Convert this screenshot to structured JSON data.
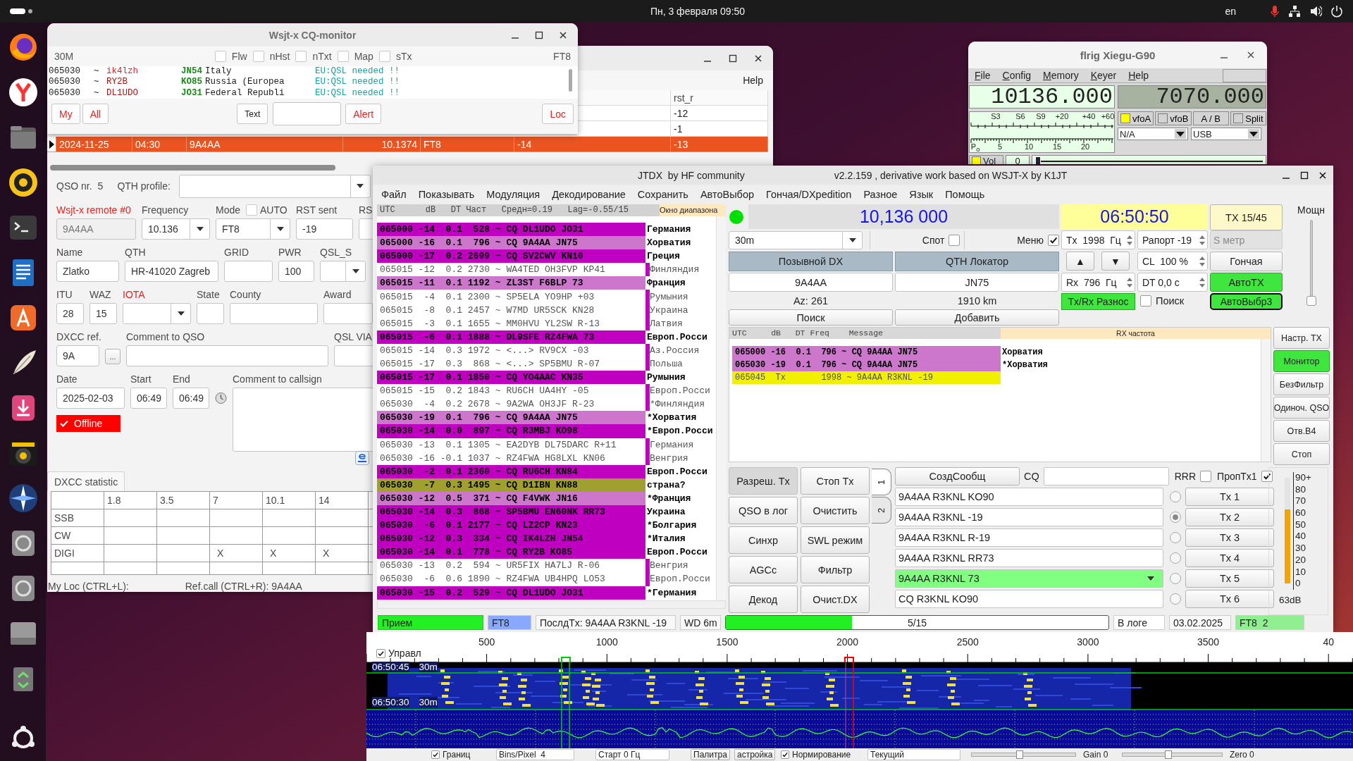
{
  "top_bar": {
    "clock": "Пн, 3 февраля 09:50",
    "language": "en"
  },
  "cq_monitor": {
    "title": "Wsjt-x CQ-monitor",
    "band": "30M",
    "mode": "FT8",
    "filters": [
      {
        "label": "Flw",
        "checked": false
      },
      {
        "label": "nHst",
        "checked": false
      },
      {
        "label": "nTxt",
        "checked": false
      },
      {
        "label": "Map",
        "checked": false
      },
      {
        "label": "sTx",
        "checked": false
      }
    ],
    "spots": [
      {
        "time": "065030",
        "sep": "~",
        "call": "ik4lzh",
        "color": "#e8202a",
        "locator": "JN54",
        "country": "Italy",
        "note": "EU:QSL needed !!"
      },
      {
        "time": "065030",
        "sep": "~",
        "call": "RY2B",
        "color": "#a01818",
        "locator": "KO85",
        "country": "Russia (Europea",
        "note": "EU:QSL needed !!"
      },
      {
        "time": "065030",
        "sep": "~",
        "call": "DL1UDO",
        "color": "#a01818",
        "locator": "JO31",
        "country": "Federal Republi",
        "note": "EU:QSL needed !!"
      }
    ],
    "my_button": "My",
    "all_button": "All",
    "text_button": "Text",
    "alert_button": "Alert",
    "loc_button": "Loc"
  },
  "log_window": {
    "menu_right": "Help",
    "header": {
      "rst_r": "rst_r"
    },
    "rows": [
      {
        "selected": false,
        "rst_r": "-12"
      },
      {
        "selected": false,
        "rst_r": "-1"
      },
      {
        "selected": true,
        "date": "2024-11-25",
        "time": "04:30",
        "call": "9A4AA",
        "freq": "10.1374",
        "mode": "FT8",
        "rst_s": "-14",
        "rst_r": "-13"
      }
    ],
    "form": {
      "qso_nr_label": "QSO nr.",
      "qso_nr": "5",
      "qth_profile_label": "QTH profile:",
      "sections": [
        {
          "fields": [
            {
              "label": "Wsjt-x remote #0",
              "warn": true,
              "kind": "field",
              "value": "9A4AA",
              "disabled": true
            },
            {
              "label": "Frequency",
              "warn": false,
              "kind": "combo",
              "value": "10.136"
            },
            {
              "label": "Mode",
              "warn": false,
              "kind": "combo",
              "value": "FT8",
              "option": {
                "label": "AUTO",
                "checked": false
              }
            },
            {
              "label": "RST sent",
              "warn": false,
              "kind": "field",
              "value": "-19"
            },
            {
              "label": "RS",
              "warn": false,
              "kind": "field"
            }
          ]
        },
        {
          "fields": [
            {
              "label": "Name",
              "warn": false,
              "kind": "field",
              "value": "Zlatko"
            },
            {
              "label": "QTH",
              "warn": false,
              "kind": "field",
              "value": "HR-41020 Zagreb"
            },
            {
              "label": "GRID",
              "warn": false,
              "kind": "field"
            },
            {
              "label": "PWR",
              "warn": false,
              "kind": "field",
              "value": "100"
            },
            {
              "label": "QSL_S",
              "warn": false,
              "kind": "combo"
            }
          ]
        },
        {
          "fields": [
            {
              "label": "ITU",
              "warn": false,
              "kind": "field",
              "value": "28"
            },
            {
              "label": "WAZ",
              "warn": false,
              "kind": "field",
              "value": "15"
            },
            {
              "label": "IOTA",
              "warn": true,
              "kind": "combo"
            },
            {
              "label": "State",
              "warn": false,
              "kind": "field"
            },
            {
              "label": "County",
              "warn": false,
              "kind": "field"
            },
            {
              "label": "Award",
              "warn": false,
              "kind": "field"
            }
          ]
        },
        {
          "fields": [
            {
              "label": "DXCC ref.",
              "warn": false,
              "kind": "field",
              "value": "9A"
            },
            {
              "kind": "button",
              "value": "..."
            },
            {
              "label": "Comment to QSO",
              "warn": false,
              "kind": "field"
            },
            {
              "label": "QSL VIA",
              "warn": false,
              "kind": "field"
            }
          ]
        },
        {
          "fields": [
            {
              "label": "Date",
              "warn": false,
              "kind": "field",
              "value": "2025-02-03"
            },
            {
              "label": "Start",
              "warn": false,
              "kind": "field",
              "value": "06:49"
            },
            {
              "label": "End",
              "warn": false,
              "kind": "field",
              "value": "06:49"
            },
            {
              "kind": "clock"
            },
            {
              "label": "Comment to callsign",
              "warn": false,
              "kind": "memo"
            }
          ]
        }
      ],
      "offline": {
        "label": "Offline",
        "checked": true
      },
      "stats_tab": "DXCC statistic",
      "stats": {
        "columns": [
          "1.8",
          "3.5",
          "7",
          "10.1",
          "14"
        ],
        "rows": [
          {
            "mode": "SSB"
          },
          {
            "mode": "CW"
          },
          {
            "mode": "DIGI",
            "cells": [
              null,
              null,
              "X",
              "X",
              "X"
            ]
          }
        ]
      },
      "my_loc": "My Loc (CTRL+L):",
      "ref_call": "Ref.call (CTRL+R): 9A4AA"
    }
  },
  "flrig": {
    "title": "flrig Xiegu-G90",
    "menu": [
      "File",
      "Config",
      "Memory",
      "Keyer",
      "Help"
    ],
    "vfo_a": "10136.000",
    "vfo_b": "7070.000",
    "s_scale": [
      "S3",
      "S6",
      "S9",
      "+20",
      "+40",
      "+60"
    ],
    "po_scale": [
      "P$_{o}$",
      "5",
      "10",
      "15",
      "20"
    ],
    "toggles": [
      {
        "label": "vfoA",
        "kind": "check",
        "checked": true
      },
      {
        "label": "vfoB",
        "kind": "check",
        "checked": false
      },
      {
        "label": "A / B",
        "kind": "plain"
      },
      {
        "label": "Split",
        "kind": "check",
        "checked": false
      }
    ],
    "combos": [
      "N/A",
      "USB"
    ],
    "volume": {
      "label": "Vol",
      "checked": true,
      "value": "0",
      "level": 0
    }
  },
  "jtdx": {
    "title": "JTDX  by HF community",
    "version": "v2.2.159 , derivative work based on WSJT-X by K1JT",
    "menu": [
      "Файл",
      "Показывать",
      "Модуляция",
      "Декодирование",
      "Сохранить",
      "АвтоВыбор",
      "Гончая/DXpedition",
      "Разное",
      "Язык",
      "Помощь"
    ],
    "band_activity": {
      "header": "UTC      dB   DT Част   Средн=0.19   Lag=-0.55/15",
      "side_header": "Окно диапазона",
      "rows": [
        {
          "text": "065000 -14  0.1  528 ~ CQ DL1UDO JO31",
          "country": "Германия",
          "color": "#c000c0",
          "bold": true
        },
        {
          "text": "065000 -16  0.1  796 ~ CQ 9A4AA JN75",
          "country": "Хорватия",
          "color": "#cc77cc",
          "bold": true
        },
        {
          "text": "065000 -17  0.2 2699 ~ CQ SV2CWV KN10",
          "country": "Греция",
          "color": "#c000c0",
          "bold": true
        },
        {
          "text": "065015 -12  0.2 2730 ~ WA4TED OH3FVP KP41",
          "country": "Финляндия",
          "color": "#ffffff",
          "bold": false
        },
        {
          "text": "065015 -11  0.1 1192 ~ ZL3ST F6BLP 73",
          "country": "Франция",
          "color": "#cc77cc",
          "bold": true
        },
        {
          "text": "065015  -4  0.1 2300 ~ SP5ELA YO9HP +03",
          "country": "Румыния",
          "color": "#ffffff",
          "bold": false
        },
        {
          "text": "065015  -8  0.1 2457 ~ W7MD UR5SCK KN28",
          "country": "Украина",
          "color": "#ffffff",
          "bold": false
        },
        {
          "text": "065015  -3  0.1 1655 ~ MM0HVU YL2SW R-13",
          "country": "Латвия",
          "color": "#ffffff",
          "bold": false
        },
        {
          "text": "065015  -6  0.1 1888 ~ DL9SFE RZ4FWA 73",
          "country": "Европ.Росси",
          "color": "#c000c0",
          "bold": true
        },
        {
          "text": "065015 -14  0.3 1972 ~ <...> RV9CX -03",
          "country": "Аз.Россия",
          "color": "#ffffff",
          "bold": false
        },
        {
          "text": "065015 -17  0.3  868 ~ <...> SP5BMU R-07",
          "country": "Польша",
          "color": "#ffffff",
          "bold": false
        },
        {
          "text": "065015 -17  0.1 1850 ~ CQ YO4AAC KN35",
          "country": "Румыния",
          "color": "#c000c0",
          "bold": true
        },
        {
          "text": "065015 -15  0.2 1843 ~ RU6CH UA4HY -05",
          "country": "Европ.Росси",
          "color": "#ffffff",
          "bold": false
        },
        {
          "text": "065030  -4  0.2 2678 ~ 9A2WA OH3JF R-23",
          "country": "*Финляндия",
          "color": "#ffffff",
          "bold": false
        },
        {
          "text": "065030 -19  0.1  796 ~ CQ 9A4AA JN75",
          "country": "*Хорватия",
          "color": "#cc77cc",
          "bold": true
        },
        {
          "text": "065030 -14  0.0  897 ~ CQ R3MBJ KO98",
          "country": "*Европ.Росси",
          "color": "#c000c0",
          "bold": true
        },
        {
          "text": "065030 -13  0.1 1305 ~ EA2DYB DL75DARC R+11",
          "country": "Германия",
          "color": "#ffffff",
          "bold": false
        },
        {
          "text": "065030 -16 -0.1 1037 ~ RZ4FWA HG8LXL KN06",
          "country": "Венгрия",
          "color": "#ffffff",
          "bold": false
        },
        {
          "text": "065030  -2  0.1 2360 ~ CQ RU6CH KN84",
          "country": "Европ.Росси",
          "color": "#c000c0",
          "bold": true
        },
        {
          "text": "065030  -7  0.3 1495 ~ CQ D1IBN KN88",
          "country": "страна?",
          "color": "#a0a030",
          "bold": true
        },
        {
          "text": "065030 -12  0.5  371 ~ CQ F4VWK JN16",
          "country": "*Франция",
          "color": "#cc77cc",
          "bold": true
        },
        {
          "text": "065030 -14  0.3  868 ~ SP5BMU EN60NK RR73",
          "country": "Украина",
          "color": "#c000c0",
          "bold": true
        },
        {
          "text": "065030  -6  0.1 2177 ~ CQ LZ2CP KN23",
          "country": "*Болгария",
          "color": "#c000c0",
          "bold": true
        },
        {
          "text": "065030 -12  0.3  334 ~ CQ IK4LZH JN54",
          "country": "*Италия",
          "color": "#c000c0",
          "bold": true
        },
        {
          "text": "065030 -14  0.1  778 ~ CQ RY2B KO85",
          "country": "Европ.Росси",
          "color": "#c000c0",
          "bold": true
        },
        {
          "text": "065030 -13  0.2  594 ~ UR5FIX HA7LJ R-06",
          "country": "Венгрия",
          "color": "#ffffff",
          "bold": false
        },
        {
          "text": "065030  -6  0.6 1890 ~ RZ4FWA UB4HPQ LO53",
          "country": "Европ.Росси",
          "color": "#ffffff",
          "bold": false
        },
        {
          "text": "065030 -15  0.2  529 ~ CQ DL1UDO JO31",
          "country": "*Германия",
          "color": "#c000c0",
          "bold": true
        }
      ]
    },
    "dial_frequency": "10,136 000",
    "clock": "06:50:50",
    "tx_period": "TX 15/45",
    "power": {
      "label": "Мощн",
      "level": 0
    },
    "band": "30m",
    "spot": {
      "label": "Спот",
      "checked": false
    },
    "menu_toggle": {
      "label": "Меню",
      "checked": true
    },
    "tx_freq": "Tx  1998  Гц",
    "report": "Рапорт -19",
    "s_meter_box": {
      "label": "S метр",
      "disabled": true
    },
    "dx_call_label": "Позывной DX",
    "dx_grid_label": "QTH Локатор",
    "up_button": "▲",
    "down_button": "▼",
    "cl": "CL  100 %",
    "hound": "Гончая",
    "dx_call": "9A4AA",
    "dx_grid": "JN75",
    "rx_freq": "Rx  796  Гц",
    "dt": "DT 0,0 с",
    "auto_tx": {
      "label": "АвтоTX",
      "on": true
    },
    "azimuth": "Az: 261",
    "distance": "1910 km",
    "split": {
      "label": "Tx/Rx Разнос",
      "on": true
    },
    "search": {
      "label": "Поиск",
      "checked": false
    },
    "auto_select": {
      "label": "АвтоВыбр3",
      "on": true
    },
    "lookup": "Поиск",
    "add": "Добавить",
    "rx_panel": {
      "header": "UTC     dB   DT Freq    Message",
      "side_header": "RX частота",
      "rows": [
        {
          "text": "065000 -16  0.1  796 ~ CQ 9A4AA JN75",
          "country": "Хорватия",
          "color": "#cc77cc",
          "bold": true
        },
        {
          "text": "065030 -19  0.1  796 ~ CQ 9A4AA JN75",
          "country": "*Хорватия",
          "color": "#cc77cc",
          "bold": true
        },
        {
          "text": "065045  Tx       1998 ~ 9A4AA R3KNL -19",
          "color": "#f0f000",
          "bold": false
        }
      ]
    },
    "side_buttons": [
      {
        "label": "Настр. TX",
        "on": false
      },
      {
        "label": "Монитор",
        "on": true
      },
      {
        "label": "БезФильтр",
        "on": false
      },
      {
        "label": "Одиноч. QSO",
        "on": false
      },
      {
        "label": "Отв.B4",
        "on": false
      },
      {
        "label": "Стоп",
        "on": false
      }
    ],
    "control_buttons": [
      {
        "label": "Разреш. Tx",
        "pressed": true
      },
      {
        "label": "Стоп Tx",
        "pressed": false
      },
      {
        "label": "QSO в лог",
        "pressed": false
      },
      {
        "label": "Очистить",
        "pressed": false
      },
      {
        "label": "Синхр",
        "pressed": false
      },
      {
        "label": "SWL режим",
        "pressed": false
      },
      {
        "label": "AGCc",
        "pressed": false
      },
      {
        "label": "Фильтр",
        "pressed": false
      },
      {
        "label": "Декод",
        "pressed": false
      },
      {
        "label": "Очист.DX",
        "pressed": false
      }
    ],
    "tabs": [
      {
        "label": "1",
        "selected": true
      },
      {
        "label": "2",
        "selected": false
      }
    ],
    "generate": "СоздСообщ",
    "cq_label": "CQ",
    "rrr": {
      "label": "RRR",
      "checked": false
    },
    "skip_tx1": {
      "label": "ПропTx1",
      "checked": true
    },
    "messages": [
      {
        "text": "9A4AA R3KNL KO90",
        "tx": "Tx 1",
        "selected": false,
        "highlighted": false
      },
      {
        "text": "9A4AA R3KNL -19",
        "tx": "Tx 2",
        "selected": true,
        "highlighted": false
      },
      {
        "text": "9A4AA R3KNL R-19",
        "tx": "Tx 3",
        "selected": false,
        "highlighted": false
      },
      {
        "text": "9A4AA R3KNL RR73",
        "tx": "Tx 4",
        "selected": false,
        "highlighted": false
      },
      {
        "text": "9A4AA R3KNL 73",
        "tx": "Tx 5",
        "selected": false,
        "highlighted": true
      },
      {
        "text": "CQ R3KNL KO90",
        "tx": "Tx 6",
        "selected": false,
        "highlighted": false
      }
    ],
    "signal_meter": {
      "scale": [
        "90+",
        "80",
        "70",
        "60",
        "50",
        "40",
        "30",
        "20",
        "10",
        "0"
      ],
      "level": 0.7,
      "reading": "63dB"
    },
    "status": {
      "rx": "Прием",
      "mode": "FT8",
      "last_tx": "ПослдTx: 9A4AA R3KNL -19",
      "wd": "WD 6m",
      "progress": {
        "text": "5/15",
        "level": 0.33
      },
      "logged": "В логе",
      "date": "03.02.2025",
      "mode_count": "FT8  2"
    }
  },
  "waterfall": {
    "control": {
      "label": "Управл",
      "checked": true
    },
    "ticks": [
      "500",
      "1000",
      "1500",
      "2000",
      "2500",
      "3000",
      "3500",
      "40"
    ],
    "times": [
      {
        "time": "06:50:45",
        "band": "30m"
      },
      {
        "time": "06:50:30",
        "band": "30m"
      }
    ],
    "bottom": [
      {
        "kind": "check",
        "label": "Границ",
        "checked": true
      },
      {
        "kind": "spin",
        "label": "Bins/Pixel  4"
      },
      {
        "kind": "spin",
        "label": "Старт 0 Гц"
      },
      {
        "kind": "button",
        "label": "Палитра"
      },
      {
        "kind": "button",
        "label": "астройка"
      },
      {
        "kind": "check",
        "label": "Нормирование",
        "checked": true
      },
      {
        "kind": "combo",
        "label": "Текущий"
      },
      {
        "kind": "slider",
        "level": 0.45
      },
      {
        "kind": "label",
        "label": "Gain 0"
      },
      {
        "kind": "slider",
        "level": 0.45
      },
      {
        "kind": "label",
        "label": "Zero 0"
      }
    ]
  }
}
